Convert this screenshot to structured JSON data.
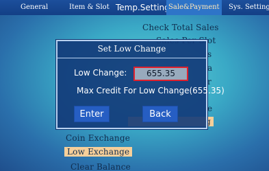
{
  "tabs": [
    {
      "label": "General"
    },
    {
      "label": "Item & Slot"
    },
    {
      "label": "Temp.Setting"
    },
    {
      "label": "Sale&Payment"
    },
    {
      "label": "Sys. Setting"
    }
  ],
  "background_menu": {
    "items": [
      {
        "label": "Check Total Sales"
      },
      {
        "label": "Sales Per Slot"
      },
      {
        "label": "s"
      },
      {
        "label": "a"
      },
      {
        "label": "r"
      },
      {
        "label": "e"
      },
      {
        "label": "g"
      },
      {
        "label": "Coin Exchange"
      },
      {
        "label": "Low Exchange"
      },
      {
        "label": "Clear Balance"
      }
    ]
  },
  "dialog": {
    "title": "Set Low Change",
    "low_change_label": "Low Change:",
    "low_change_value": "655.35",
    "max_credit_text": "Max Credit For Low Change(655.35)",
    "enter_label": "Enter",
    "back_label": "Back"
  }
}
